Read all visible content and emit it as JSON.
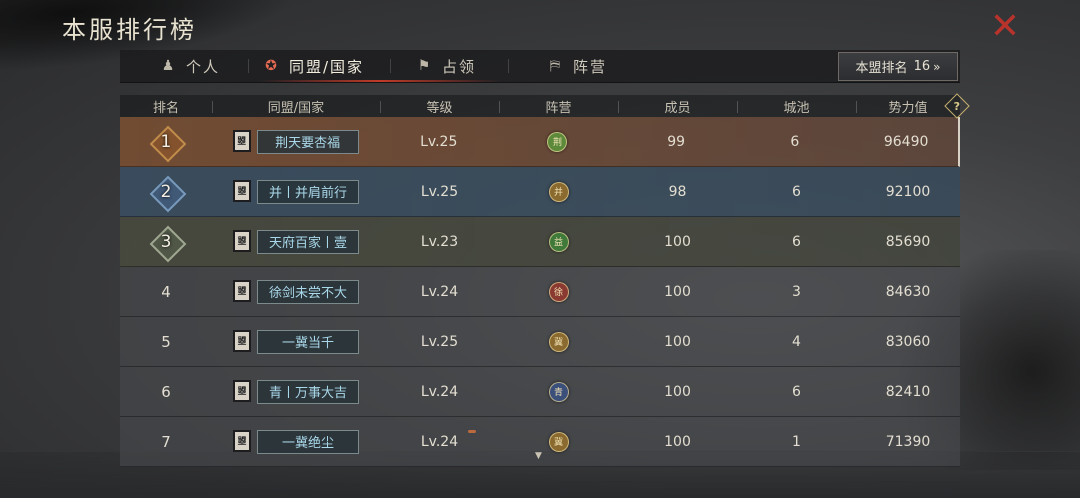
{
  "window": {
    "title": "本服排行榜"
  },
  "colors": {
    "close": "#b8332c",
    "active_tab_icon": "#e56a52",
    "ally_name": "#a9d8ea"
  },
  "tabs": [
    {
      "label": "个人",
      "icon": "person-chess-icon"
    },
    {
      "label": "同盟/国家",
      "icon": "alliance-emblem-icon"
    },
    {
      "label": "占领",
      "icon": "flag-icon"
    },
    {
      "label": "阵营",
      "icon": "banner-icon"
    }
  ],
  "active_tab": 1,
  "alliance_rank_button": {
    "label": "本盟排名",
    "value": "16",
    "chevron": "»"
  },
  "table": {
    "headers": [
      "排名",
      "同盟/国家",
      "等级",
      "阵营",
      "成员",
      "城池",
      "势力值"
    ],
    "help_glyph": "?",
    "rows": [
      {
        "rank": "1",
        "flag": "曌",
        "name": "荆天要杏福",
        "level": "Lv.25",
        "camp": "荆",
        "camp_color": "#5c8a3a",
        "members": "99",
        "cities": "6",
        "power": "96490"
      },
      {
        "rank": "2",
        "flag": "曌",
        "name": "并丨并肩前行",
        "level": "Lv.25",
        "camp": "并",
        "camp_color": "#8a6a2e",
        "members": "98",
        "cities": "6",
        "power": "92100"
      },
      {
        "rank": "3",
        "flag": "曌",
        "name": "天府百家丨壹",
        "level": "Lv.23",
        "camp": "益",
        "camp_color": "#3f7a3a",
        "members": "100",
        "cities": "6",
        "power": "85690"
      },
      {
        "rank": "4",
        "flag": "曌",
        "name": "徐剑未尝不大",
        "level": "Lv.24",
        "camp": "徐",
        "camp_color": "#8a3a30",
        "members": "100",
        "cities": "3",
        "power": "84630"
      },
      {
        "rank": "5",
        "flag": "曌",
        "name": "一冀当千",
        "level": "Lv.25",
        "camp": "冀",
        "camp_color": "#8a6a2e",
        "members": "100",
        "cities": "4",
        "power": "83060"
      },
      {
        "rank": "6",
        "flag": "曌",
        "name": "青丨万事大吉",
        "level": "Lv.24",
        "camp": "青",
        "camp_color": "#3a4f7a",
        "members": "100",
        "cities": "6",
        "power": "82410"
      },
      {
        "rank": "7",
        "flag": "曌",
        "name": "一冀绝尘",
        "level": "Lv.24",
        "camp": "冀",
        "camp_color": "#8a6a2e",
        "members": "100",
        "cities": "1",
        "power": "71390"
      }
    ]
  }
}
